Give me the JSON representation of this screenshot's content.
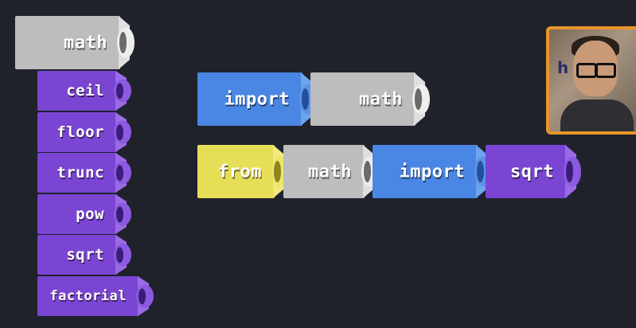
{
  "left_stack": {
    "header": "math",
    "items": [
      "ceil",
      "floor",
      "trunc",
      "pow",
      "sqrt",
      "factorial"
    ]
  },
  "statement_1": {
    "keyword": "import",
    "module": "math"
  },
  "statement_2": {
    "from_keyword": "from",
    "module": "math",
    "import_keyword": "import",
    "name": "sqrt"
  },
  "webcam": {
    "sign_text": "h    t"
  },
  "colors": {
    "background": "#1f222b",
    "module_block": "#bdbdbd",
    "function_block": "#7a45d3",
    "import_block": "#4a86e4",
    "from_block": "#e6de57",
    "webcam_border": "#e8952a"
  }
}
